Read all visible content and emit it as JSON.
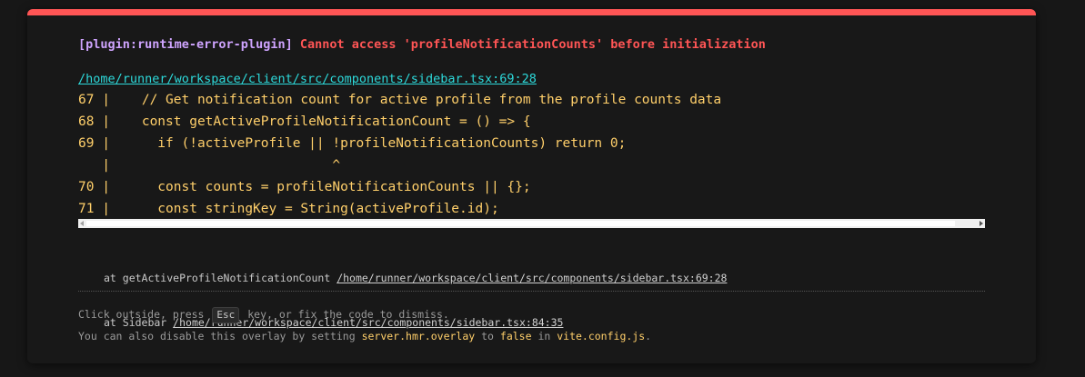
{
  "colors": {
    "accent_bar": "#ff5555",
    "plugin_name": "#cfa4ff",
    "error_message": "#ff5555",
    "file_link": "#2dd9da",
    "code_text": "#ffcf6a"
  },
  "error": {
    "plugin": "[plugin:runtime-error-plugin]",
    "message": "Cannot access 'profileNotificationCounts' before initialization",
    "file": "/home/runner/workspace/client/src/components/sidebar.tsx:69:28"
  },
  "frame": {
    "lines": [
      "67 |    // Get notification count for active profile from the profile counts data",
      "68 |    const getActiveProfileNotificationCount = () => {",
      "69 |      if (!activeProfile || !profileNotificationCounts) return 0;",
      "   |                            ^",
      "70 |      const counts = profileNotificationCounts || {};",
      "71 |      const stringKey = String(activeProfile.id);"
    ]
  },
  "stack": [
    {
      "prefix": "at getActiveProfileNotificationCount ",
      "link": "/home/runner/workspace/client/src/components/sidebar.tsx:69:28"
    },
    {
      "prefix": "at Sidebar ",
      "link": "/home/runner/workspace/client/src/components/sidebar.tsx:84:35"
    }
  ],
  "tip": {
    "line1_before": "Click outside, press",
    "key": "Esc",
    "line1_after": "key, or fix the code to dismiss.",
    "line2_before": "You can also disable this overlay by setting ",
    "setting": "server.hmr.overlay",
    "line2_mid": " to ",
    "value": "false",
    "line2_mid2": " in ",
    "config_file": "vite.config.js",
    "line2_end": "."
  }
}
